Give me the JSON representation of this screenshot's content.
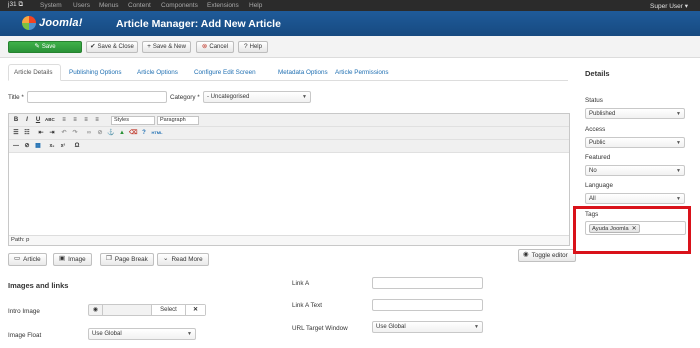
{
  "menubar": {
    "site": "j31 ⧉",
    "items": [
      "System",
      "Users",
      "Menus",
      "Content",
      "Components",
      "Extensions",
      "Help"
    ],
    "user": "Super User ▾"
  },
  "header": {
    "logo_text": "Joomla!",
    "title": "Article Manager: Add New Article"
  },
  "toolbar": {
    "save": "Save",
    "save_close": "Save & Close",
    "save_new": "Save & New",
    "cancel": "Cancel",
    "help": "Help"
  },
  "tabs": [
    "Article Details",
    "Publishing Options",
    "Article Options",
    "Configure Edit Screen",
    "Metadata Options",
    "Article Permissions"
  ],
  "form": {
    "title_label": "Title *",
    "title_value": "",
    "category_label": "Category *",
    "category_value": "- Uncategorised"
  },
  "editor": {
    "styles": "Styles",
    "paragraph": "Paragraph",
    "path": "Path: p"
  },
  "editor_buttons": {
    "article": "Article",
    "image": "Image",
    "page_break": "Page Break",
    "read_more": "Read More",
    "toggle_editor": "Toggle editor"
  },
  "images_links": {
    "title": "Images and links",
    "intro_image_label": "Intro Image",
    "select": "Select",
    "image_float_label": "Image Float",
    "image_float_value": "Use Global",
    "link_a_label": "Link A",
    "link_a_text_label": "Link A Text",
    "url_target_label": "URL Target Window",
    "url_target_value": "Use Global"
  },
  "details": {
    "title": "Details",
    "status_label": "Status",
    "status_value": "Published",
    "access_label": "Access",
    "access_value": "Public",
    "featured_label": "Featured",
    "featured_value": "No",
    "language_label": "Language",
    "language_value": "All",
    "tags_label": "Tags",
    "tag": "Ayuda Joomla"
  },
  "colors": {
    "header_blue": "#1f5b9a",
    "save_green": "#3fb14a",
    "link_blue": "#1f6fb2",
    "highlight_red": "#d9121a"
  }
}
